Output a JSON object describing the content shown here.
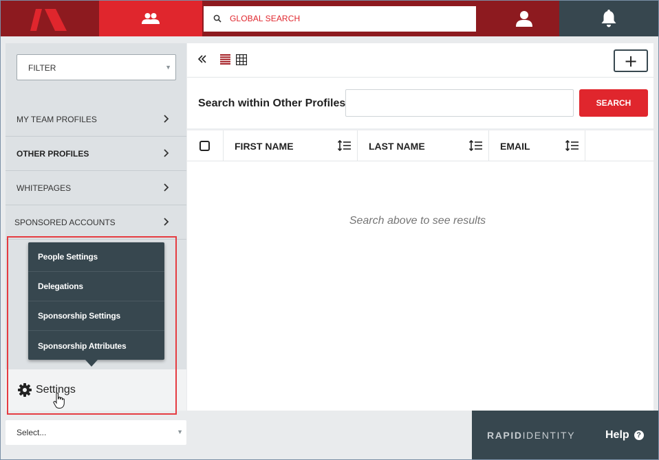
{
  "topbar": {
    "search_placeholder": "GLOBAL SEARCH",
    "icons": [
      "app-logo-icon",
      "people-icon",
      "search-icon",
      "user-icon",
      "bell-icon"
    ]
  },
  "sidebar": {
    "filter_label": "FILTER",
    "items": [
      {
        "label": "MY TEAM PROFILES",
        "active": false
      },
      {
        "label": "OTHER PROFILES",
        "active": true
      },
      {
        "label": "WHITEPAGES",
        "active": false
      },
      {
        "label": "SPONSORED ACCOUNTS",
        "active": false
      }
    ],
    "settings_label": "Settings",
    "select_placeholder": "Select..."
  },
  "settings_menu": {
    "items": [
      {
        "label": "People Settings"
      },
      {
        "label": "Delegations"
      },
      {
        "label": "Sponsorship Settings"
      },
      {
        "label": "Sponsorship Attributes"
      }
    ]
  },
  "main": {
    "add_label": "+",
    "search_label": "Search within Other Profiles:",
    "search_value": "",
    "search_button": "SEARCH",
    "columns": [
      {
        "label": "FIRST NAME"
      },
      {
        "label": "LAST NAME"
      },
      {
        "label": "EMAIL"
      }
    ],
    "empty_message": "Search above to see results"
  },
  "footer": {
    "brand_part1": "RAPID",
    "brand_part2": "IDENTITY",
    "help_label": "Help",
    "help_icon": "?"
  },
  "colors": {
    "brand_red": "#e0262d",
    "dark_red": "#8d1a1f",
    "slate": "#37474f",
    "highlight_red": "#e53a40"
  }
}
